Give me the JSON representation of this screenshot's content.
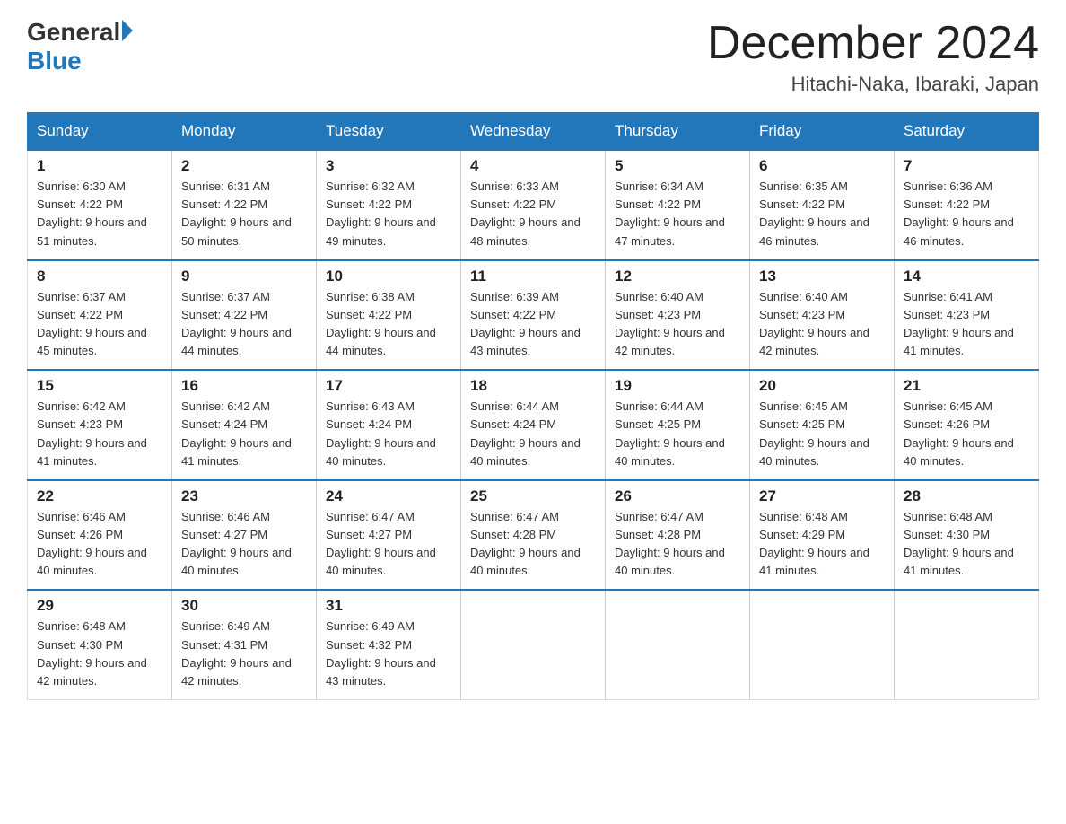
{
  "logo": {
    "general": "General",
    "triangle": "▶",
    "blue": "Blue"
  },
  "title": {
    "month_year": "December 2024",
    "location": "Hitachi-Naka, Ibaraki, Japan"
  },
  "weekdays": [
    "Sunday",
    "Monday",
    "Tuesday",
    "Wednesday",
    "Thursday",
    "Friday",
    "Saturday"
  ],
  "weeks": [
    [
      {
        "day": "1",
        "sunrise": "6:30 AM",
        "sunset": "4:22 PM",
        "daylight": "9 hours and 51 minutes."
      },
      {
        "day": "2",
        "sunrise": "6:31 AM",
        "sunset": "4:22 PM",
        "daylight": "9 hours and 50 minutes."
      },
      {
        "day": "3",
        "sunrise": "6:32 AM",
        "sunset": "4:22 PM",
        "daylight": "9 hours and 49 minutes."
      },
      {
        "day": "4",
        "sunrise": "6:33 AM",
        "sunset": "4:22 PM",
        "daylight": "9 hours and 48 minutes."
      },
      {
        "day": "5",
        "sunrise": "6:34 AM",
        "sunset": "4:22 PM",
        "daylight": "9 hours and 47 minutes."
      },
      {
        "day": "6",
        "sunrise": "6:35 AM",
        "sunset": "4:22 PM",
        "daylight": "9 hours and 46 minutes."
      },
      {
        "day": "7",
        "sunrise": "6:36 AM",
        "sunset": "4:22 PM",
        "daylight": "9 hours and 46 minutes."
      }
    ],
    [
      {
        "day": "8",
        "sunrise": "6:37 AM",
        "sunset": "4:22 PM",
        "daylight": "9 hours and 45 minutes."
      },
      {
        "day": "9",
        "sunrise": "6:37 AM",
        "sunset": "4:22 PM",
        "daylight": "9 hours and 44 minutes."
      },
      {
        "day": "10",
        "sunrise": "6:38 AM",
        "sunset": "4:22 PM",
        "daylight": "9 hours and 44 minutes."
      },
      {
        "day": "11",
        "sunrise": "6:39 AM",
        "sunset": "4:22 PM",
        "daylight": "9 hours and 43 minutes."
      },
      {
        "day": "12",
        "sunrise": "6:40 AM",
        "sunset": "4:23 PM",
        "daylight": "9 hours and 42 minutes."
      },
      {
        "day": "13",
        "sunrise": "6:40 AM",
        "sunset": "4:23 PM",
        "daylight": "9 hours and 42 minutes."
      },
      {
        "day": "14",
        "sunrise": "6:41 AM",
        "sunset": "4:23 PM",
        "daylight": "9 hours and 41 minutes."
      }
    ],
    [
      {
        "day": "15",
        "sunrise": "6:42 AM",
        "sunset": "4:23 PM",
        "daylight": "9 hours and 41 minutes."
      },
      {
        "day": "16",
        "sunrise": "6:42 AM",
        "sunset": "4:24 PM",
        "daylight": "9 hours and 41 minutes."
      },
      {
        "day": "17",
        "sunrise": "6:43 AM",
        "sunset": "4:24 PM",
        "daylight": "9 hours and 40 minutes."
      },
      {
        "day": "18",
        "sunrise": "6:44 AM",
        "sunset": "4:24 PM",
        "daylight": "9 hours and 40 minutes."
      },
      {
        "day": "19",
        "sunrise": "6:44 AM",
        "sunset": "4:25 PM",
        "daylight": "9 hours and 40 minutes."
      },
      {
        "day": "20",
        "sunrise": "6:45 AM",
        "sunset": "4:25 PM",
        "daylight": "9 hours and 40 minutes."
      },
      {
        "day": "21",
        "sunrise": "6:45 AM",
        "sunset": "4:26 PM",
        "daylight": "9 hours and 40 minutes."
      }
    ],
    [
      {
        "day": "22",
        "sunrise": "6:46 AM",
        "sunset": "4:26 PM",
        "daylight": "9 hours and 40 minutes."
      },
      {
        "day": "23",
        "sunrise": "6:46 AM",
        "sunset": "4:27 PM",
        "daylight": "9 hours and 40 minutes."
      },
      {
        "day": "24",
        "sunrise": "6:47 AM",
        "sunset": "4:27 PM",
        "daylight": "9 hours and 40 minutes."
      },
      {
        "day": "25",
        "sunrise": "6:47 AM",
        "sunset": "4:28 PM",
        "daylight": "9 hours and 40 minutes."
      },
      {
        "day": "26",
        "sunrise": "6:47 AM",
        "sunset": "4:28 PM",
        "daylight": "9 hours and 40 minutes."
      },
      {
        "day": "27",
        "sunrise": "6:48 AM",
        "sunset": "4:29 PM",
        "daylight": "9 hours and 41 minutes."
      },
      {
        "day": "28",
        "sunrise": "6:48 AM",
        "sunset": "4:30 PM",
        "daylight": "9 hours and 41 minutes."
      }
    ],
    [
      {
        "day": "29",
        "sunrise": "6:48 AM",
        "sunset": "4:30 PM",
        "daylight": "9 hours and 42 minutes."
      },
      {
        "day": "30",
        "sunrise": "6:49 AM",
        "sunset": "4:31 PM",
        "daylight": "9 hours and 42 minutes."
      },
      {
        "day": "31",
        "sunrise": "6:49 AM",
        "sunset": "4:32 PM",
        "daylight": "9 hours and 43 minutes."
      },
      null,
      null,
      null,
      null
    ]
  ]
}
